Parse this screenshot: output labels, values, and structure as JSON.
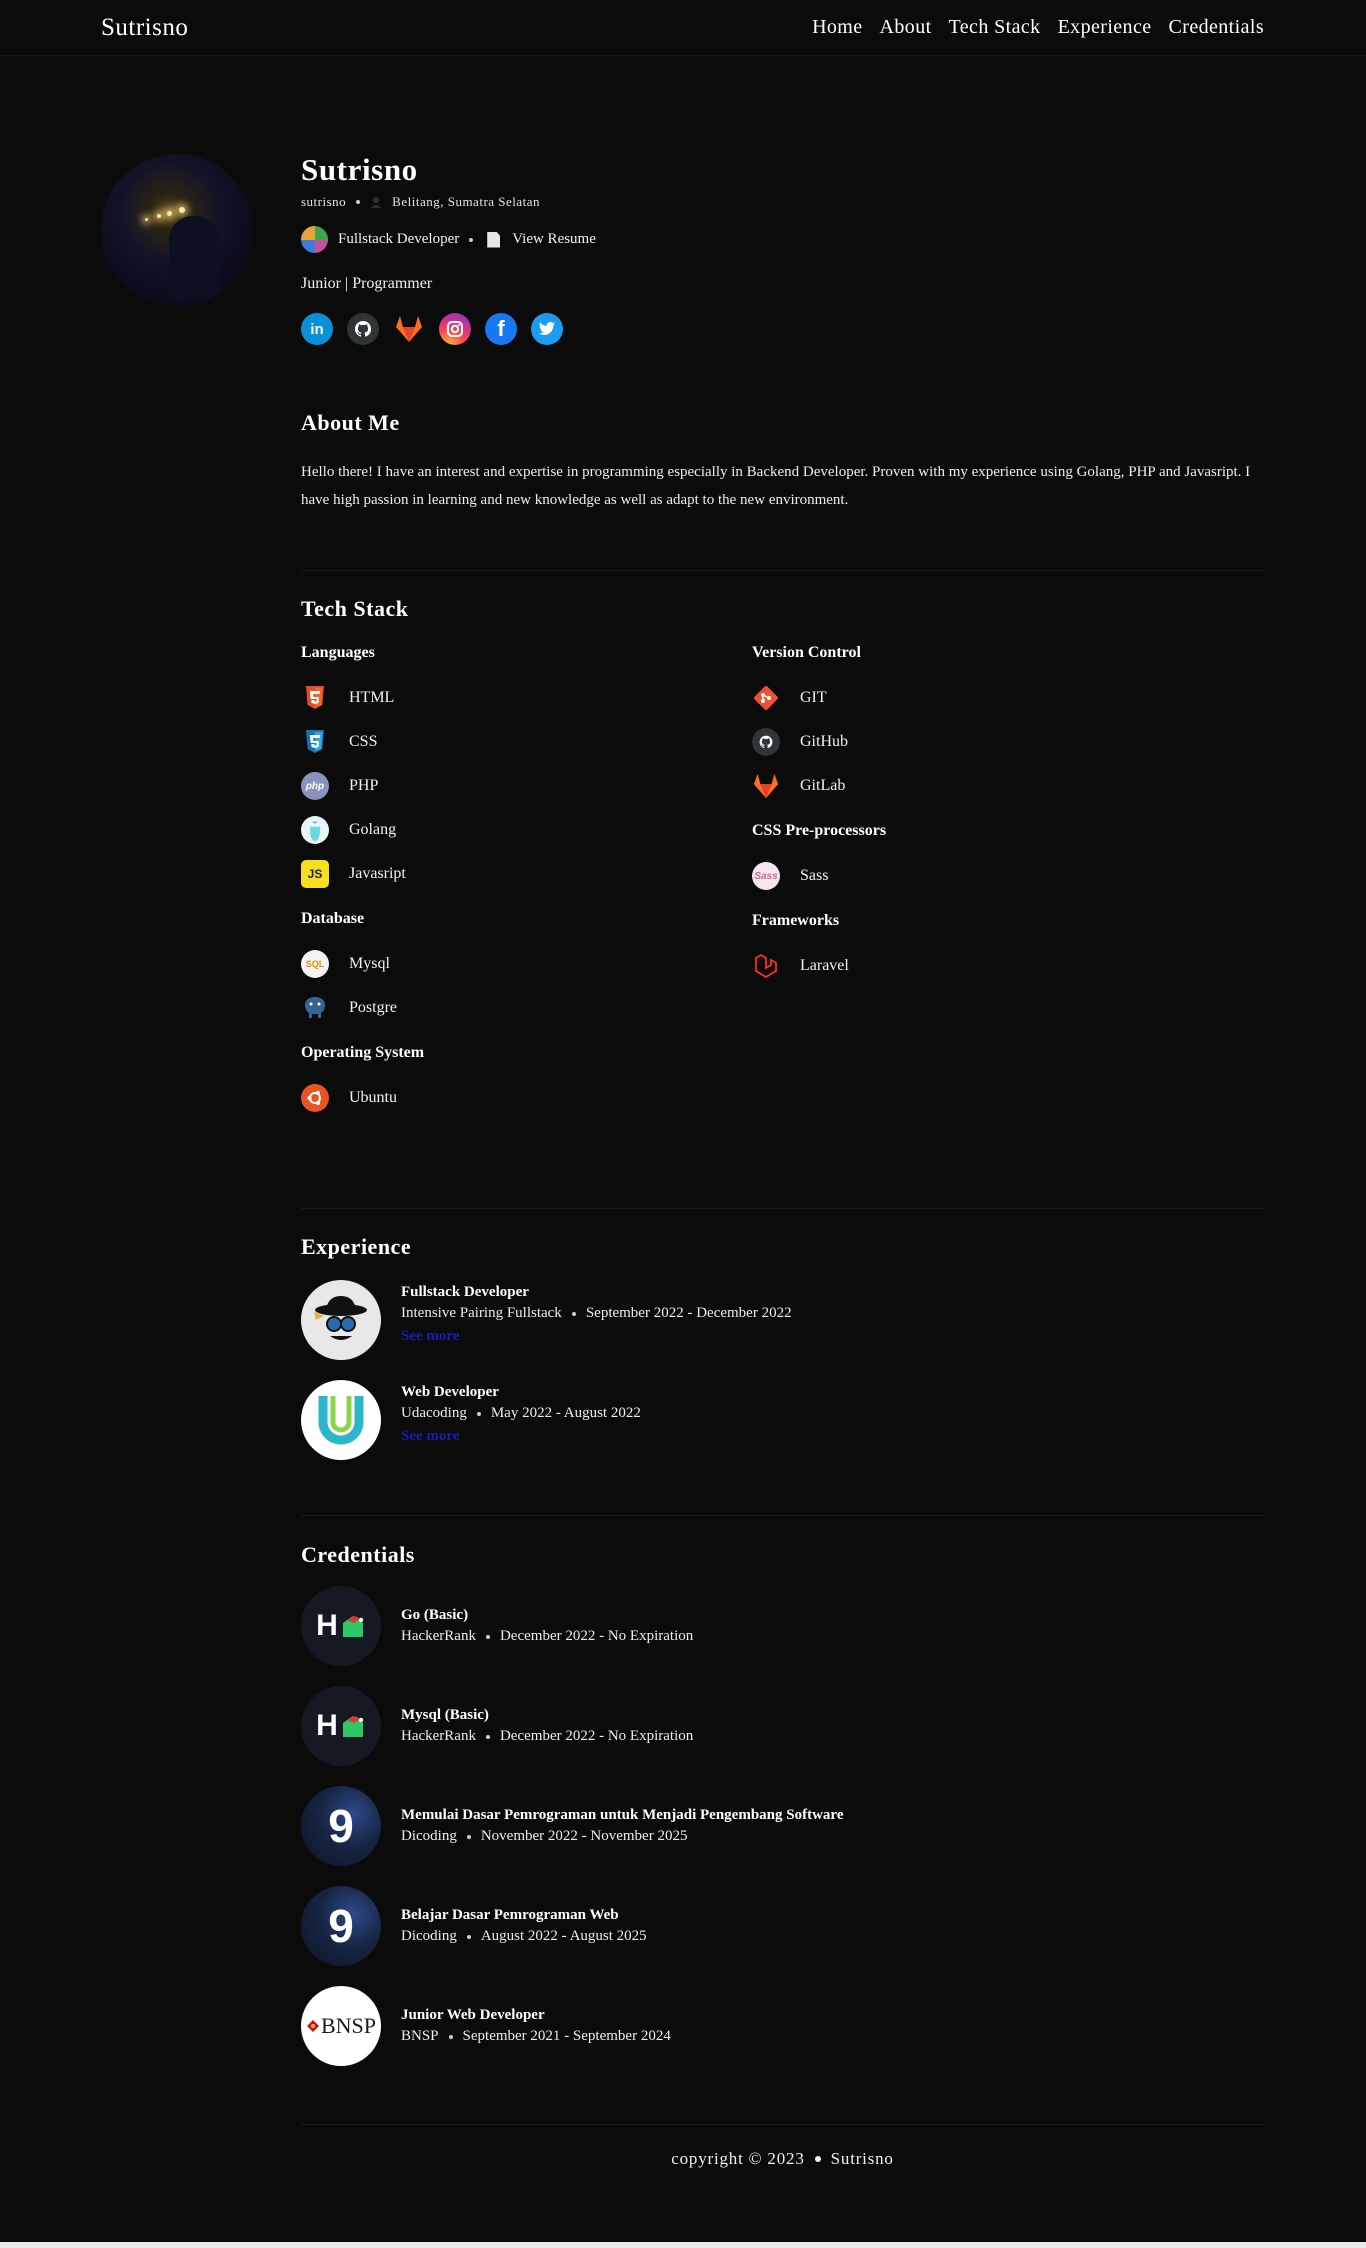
{
  "nav": {
    "brand": "Sutrisno",
    "links": [
      "Home",
      "About",
      "Tech Stack",
      "Experience",
      "Credentials"
    ]
  },
  "profile": {
    "name": "Sutrisno",
    "username": "sutrisno",
    "location": "Belitang, Sumatra Selatan",
    "role": "Fullstack Developer",
    "resume_label": "View Resume",
    "tagline": "Junior | Programmer",
    "socials": [
      "linkedin-icon",
      "github-icon",
      "gitlab-icon",
      "instagram-icon",
      "facebook-icon",
      "twitter-icon"
    ]
  },
  "about": {
    "heading": "About Me",
    "text": "Hello there! I have an interest and expertise in programming especially in Backend Developer. Proven with my experience using Golang, PHP and Javasript. I have high passion in learning and new knowledge as well as adapt to the new environment."
  },
  "tech": {
    "heading": "Tech Stack",
    "languages": {
      "title": "Languages",
      "items": [
        "HTML",
        "CSS",
        "PHP",
        "Golang",
        "Javasript"
      ]
    },
    "database": {
      "title": "Database",
      "items": [
        "Mysql",
        "Postgre"
      ]
    },
    "os": {
      "title": "Operating System",
      "items": [
        "Ubuntu"
      ]
    },
    "vcs": {
      "title": "Version Control",
      "items": [
        "GIT",
        "GitHub",
        "GitLab"
      ]
    },
    "css_pre": {
      "title": "CSS Pre-processors",
      "items": [
        "Sass"
      ]
    },
    "frameworks": {
      "title": "Frameworks",
      "items": [
        "Laravel"
      ]
    }
  },
  "experience": {
    "heading": "Experience",
    "see_more": "See more",
    "items": [
      {
        "title": "Fullstack Developer",
        "company": "Intensive Pairing Fullstack",
        "period": "September 2022 - December 2022"
      },
      {
        "title": "Web Developer",
        "company": "Udacoding",
        "period": "May 2022 - August 2022"
      }
    ]
  },
  "credentials": {
    "heading": "Credentials",
    "items": [
      {
        "title": "Go (Basic)",
        "issuer": "HackerRank",
        "period": "December 2022 - No Expiration"
      },
      {
        "title": "Mysql (Basic)",
        "issuer": "HackerRank",
        "period": "December 2022 - No Expiration"
      },
      {
        "title": "Memulai Dasar Pemrograman untuk Menjadi Pengembang Software",
        "issuer": "Dicoding",
        "period": "November 2022 - November 2025"
      },
      {
        "title": "Belajar Dasar Pemrograman Web",
        "issuer": "Dicoding",
        "period": "August 2022 - August 2025"
      },
      {
        "title": "Junior Web Developer",
        "issuer": "BNSP",
        "period": "September 2021 - September 2024"
      }
    ],
    "logo_text": {
      "hackerrank": "H",
      "dicoding": "9",
      "bnsp": "BNSP"
    }
  },
  "footer": {
    "copyright": "copyright © 2023",
    "owner": "Sutrisno"
  },
  "colors": {
    "background": "#0b0b0b",
    "text": "#f2f2f2",
    "link": "#1a1fb0"
  }
}
